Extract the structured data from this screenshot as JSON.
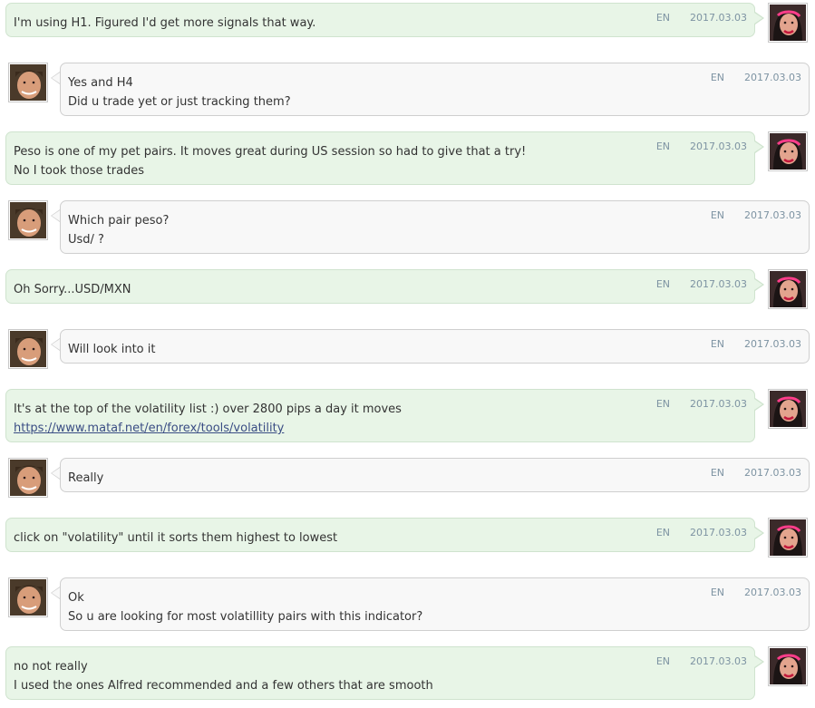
{
  "messages": [
    {
      "side": "self",
      "lang": "EN",
      "date": "2017.03.03",
      "lines": [
        "I'm using H1. Figured I'd get more signals that way."
      ]
    },
    {
      "side": "other",
      "lang": "EN",
      "date": "2017.03.03",
      "lines": [
        "Yes and H4",
        "Did u trade yet or just tracking them?"
      ]
    },
    {
      "side": "self",
      "lang": "EN",
      "date": "2017.03.03",
      "lines": [
        "Peso is one of my pet pairs. It moves great during US session so had to give that a try!",
        "No I took those trades"
      ]
    },
    {
      "side": "other",
      "lang": "EN",
      "date": "2017.03.03",
      "lines": [
        "Which pair peso?",
        "Usd/ ?"
      ]
    },
    {
      "side": "self",
      "lang": "EN",
      "date": "2017.03.03",
      "lines": [
        "Oh Sorry...USD/MXN"
      ]
    },
    {
      "side": "other",
      "lang": "EN",
      "date": "2017.03.03",
      "lines": [
        "Will look into it"
      ]
    },
    {
      "side": "self",
      "lang": "EN",
      "date": "2017.03.03",
      "lines": [
        "It's at the top of the volatility list :) over 2800 pips a day it moves"
      ],
      "link": "https://www.mataf.net/en/forex/tools/volatility"
    },
    {
      "side": "other",
      "lang": "EN",
      "date": "2017.03.03",
      "lines": [
        "Really"
      ]
    },
    {
      "side": "self",
      "lang": "EN",
      "date": "2017.03.03",
      "lines": [
        "click on \"volatility\" until it sorts them highest to lowest"
      ]
    },
    {
      "side": "other",
      "lang": "EN",
      "date": "2017.03.03",
      "lines": [
        "Ok",
        "So u are looking for most volatillity pairs with this indicator?"
      ]
    },
    {
      "side": "self",
      "lang": "EN",
      "date": "2017.03.03",
      "lines": [
        "no not really",
        "I used the ones Alfred recommended and a few others that are smooth"
      ]
    }
  ],
  "colors": {
    "self_bubble": "#e8f5e7",
    "other_bubble": "#f8f8f8",
    "meta_text": "#7d93a2",
    "link": "#3a4d84"
  }
}
